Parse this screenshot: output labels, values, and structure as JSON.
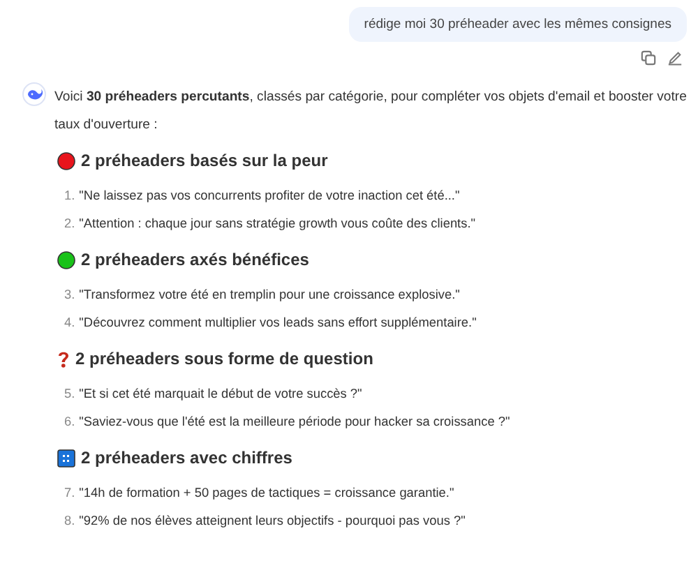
{
  "user_message": {
    "text": "rédige moi 30 préheader avec les mêmes consignes"
  },
  "assistant_message": {
    "intro": "Voici **30 préheaders percutants**, classés par catégorie, pour compléter vos objets d'email et booster votre taux d'ouverture :",
    "sections": [
      {
        "kind": "red-circle",
        "title": "2 préheaders basés sur la peur",
        "items": [
          {
            "number": "1.",
            "text": "\"Ne laissez pas vos concurrents profiter de votre inaction cet été...\""
          },
          {
            "number": "2.",
            "text": "\"Attention : chaque jour sans stratégie growth vous coûte des clients.\""
          }
        ]
      },
      {
        "kind": "green-circle",
        "title": "2 préheaders axés bénéfices",
        "items": [
          {
            "number": "3.",
            "text": "\"Transformez votre été en tremplin pour une croissance explosive.\""
          },
          {
            "number": "4.",
            "text": "\"Découvrez comment multiplier vos leads sans effort supplémentaire.\""
          }
        ]
      },
      {
        "kind": "question",
        "title": "2 préheaders sous forme de question",
        "items": [
          {
            "number": "5.",
            "text": "\"Et si cet été marquait le début de votre succès ?\""
          },
          {
            "number": "6.",
            "text": "\"Saviez-vous que l'été est la meilleure période pour hacker sa croissance ?\""
          }
        ]
      },
      {
        "kind": "numbers",
        "title": "2 préheaders avec chiffres",
        "items": [
          {
            "number": "7.",
            "text": "\"14h de formation + 50 pages de tactiques = croissance garantie.\""
          },
          {
            "number": "8.",
            "text": "\"92% de nos élèves atteignent leurs objectifs - pourquoi pas vous ?\""
          }
        ]
      }
    ]
  }
}
